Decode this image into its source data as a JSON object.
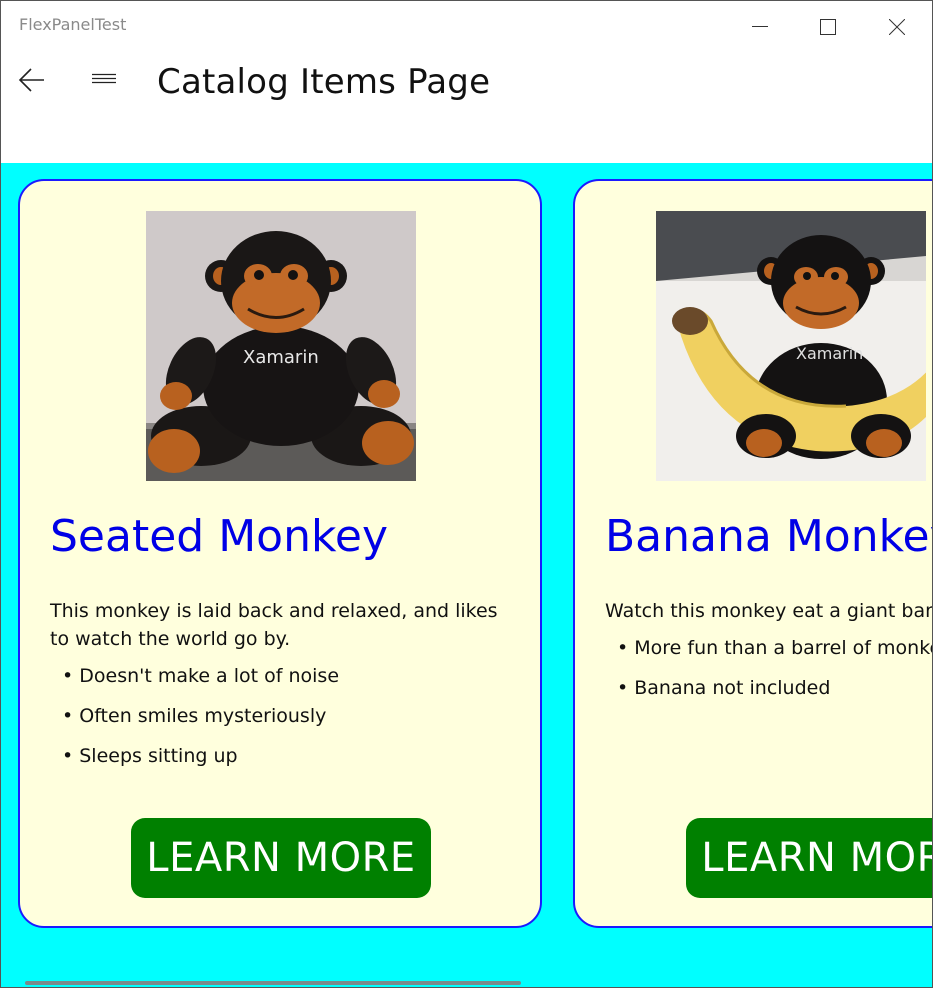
{
  "window": {
    "app_title": "FlexPanelTest"
  },
  "nav": {
    "page_title": "Catalog Items Page"
  },
  "colors": {
    "content_background": "#00ffff",
    "card_background": "#ffffdd",
    "card_border": "#1a1aff",
    "title_color": "#0000e6",
    "button_color": "#008000"
  },
  "cards": [
    {
      "title": "Seated Monkey",
      "description": "This monkey is laid back and relaxed, and likes to watch the world go by.",
      "bullets": [
        "Doesn't make a lot of noise",
        "Often smiles mysteriously",
        "Sleeps sitting up"
      ],
      "button_label": "LEARN MORE",
      "image_icon": "seated-monkey-photo"
    },
    {
      "title": "Banana Monkey",
      "description": "Watch this monkey eat a giant banana.",
      "bullets": [
        "More fun than a barrel of monkeys",
        "Banana not included"
      ],
      "button_label": "LEARN MORE",
      "image_icon": "banana-monkey-photo"
    }
  ]
}
